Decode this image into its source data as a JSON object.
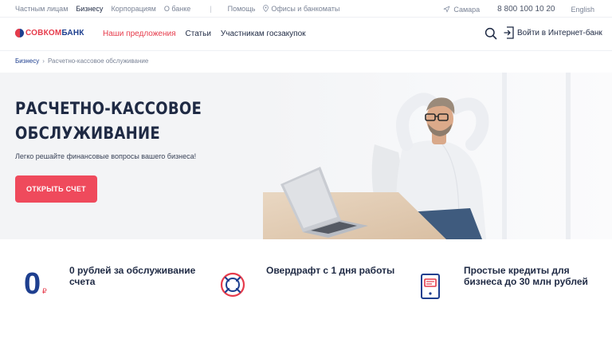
{
  "topbar": {
    "segments": [
      "Частным лицам",
      "Бизнесу",
      "Корпорациям",
      "О банке"
    ],
    "separator": "|",
    "help": "Помощь",
    "offices": "Офисы и банкоматы",
    "city": "Самара",
    "phone": "8 800 100 10 20",
    "language": "English"
  },
  "header": {
    "logo_part1": "СОВКОМ",
    "logo_part2": "БАНК",
    "nav": [
      "Наши предложения",
      "Статьи",
      "Участникам госзакупок"
    ],
    "login": "Войти в Интернет-банк"
  },
  "breadcrumb": {
    "parent": "Бизнесу",
    "current": "Расчетно-кассовое обслуживание"
  },
  "hero": {
    "title_line1": "Расчетно-кассовое",
    "title_line2": "обслуживание",
    "subtitle": "Легко решайте финансовые вопросы вашего бизнеса!",
    "cta": "ОТКРЫТЬ СЧЕТ"
  },
  "features": [
    {
      "value": "0",
      "currency": "₽",
      "text": "0 рублей за обслуживание счета"
    },
    {
      "text": "Овердрафт с 1 дня работы"
    },
    {
      "text": "Простые кредиты для бизнеса до 30 млн рублей"
    }
  ],
  "colors": {
    "brand_red": "#e63b4b",
    "brand_blue": "#1e3f8f",
    "cta": "#ef4a5c"
  }
}
